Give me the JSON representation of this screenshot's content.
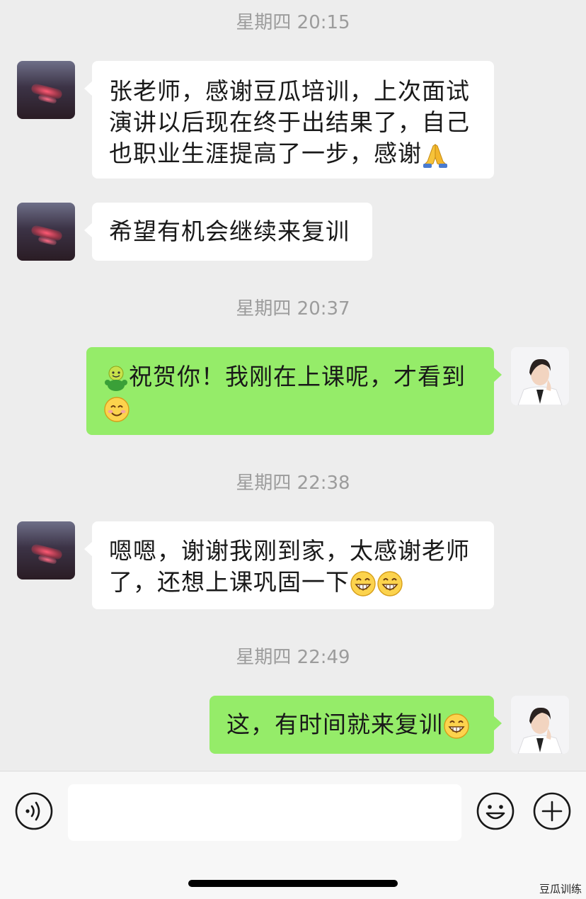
{
  "messages": [
    {
      "type": "time",
      "text": "星期四 20:15"
    },
    {
      "type": "msg",
      "side": "in",
      "text": "张老师，感谢豆瓜培训，上次面试演讲以后现在终于出结果了，自己也职业生涯提高了一步，感谢",
      "emoji": [
        "folded-hands-emoji"
      ]
    },
    {
      "type": "msg",
      "side": "in",
      "text": "希望有机会继续来复训"
    },
    {
      "type": "time",
      "text": "星期四 20:37"
    },
    {
      "type": "msg",
      "side": "out",
      "text": "祝贺你！我刚在上课呢，才看到",
      "emoji": [
        "celebrate-emoji",
        "smile-emoji"
      ]
    },
    {
      "type": "time",
      "text": "星期四 22:38"
    },
    {
      "type": "msg",
      "side": "in",
      "text": "嗯嗯，谢谢我刚到家，太感谢老师了，还想上课巩固一下",
      "emoji": [
        "grin-emoji",
        "grin-emoji"
      ]
    },
    {
      "type": "time",
      "text": "星期四 22:49"
    },
    {
      "type": "msg",
      "side": "out",
      "text": "这，有时间就来复训",
      "emoji": [
        "grin-emoji"
      ]
    }
  ],
  "ui": {
    "times": [
      "星期四 20:15",
      "星期四 20:37",
      "星期四 22:38",
      "星期四 22:49"
    ],
    "m1_line1": "张老师，感谢豆瓜培训，上次面试",
    "m1_line2": "演讲以后现在终于出结果了，自己",
    "m1_line3": "也职业生涯提高了一步，感谢",
    "m2": "希望有机会继续来复训",
    "m3_line1": "祝贺你！我刚在上课呢，才看到",
    "m4_line1": "嗯嗯，谢谢我刚到家，太感谢老师",
    "m4_line2": "了，还想上课巩固一下",
    "m5": "这，有时间就来复训"
  },
  "input_bar": {
    "voice_icon": "voice-icon",
    "input_value": "",
    "emoji_icon": "emoji-icon",
    "add_icon": "plus-icon"
  },
  "watermark": "豆瓜训练",
  "colors": {
    "background": "#ededed",
    "incoming_bubble": "#ffffff",
    "outgoing_bubble": "#95ec69",
    "timestamp": "#9c9c9c"
  }
}
